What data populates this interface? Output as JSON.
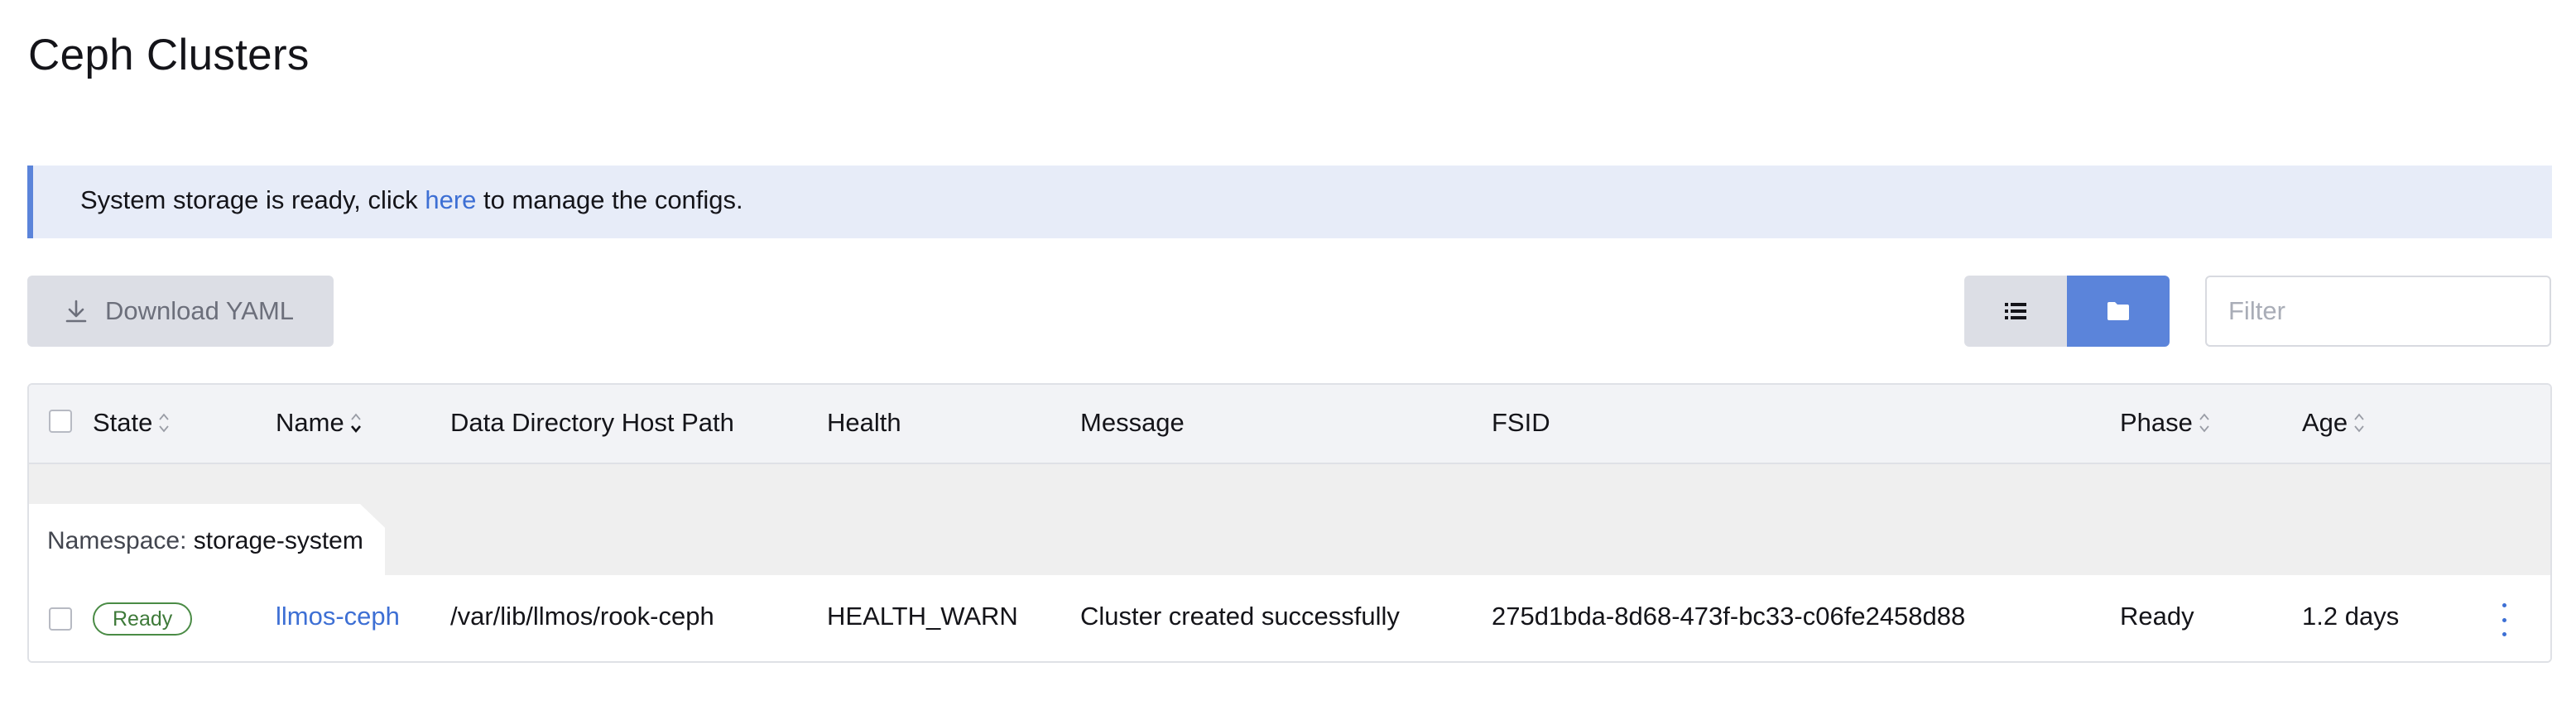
{
  "page": {
    "title": "Ceph Clusters"
  },
  "banner": {
    "text_before": "System storage is ready, click ",
    "link_text": "here",
    "text_after": " to manage the configs."
  },
  "toolbar": {
    "download_label": "Download YAML",
    "download_icon": "download-icon",
    "list_view_icon": "list-icon",
    "folder_view_icon": "folder-icon",
    "active_view": "folder",
    "filter_placeholder": "Filter",
    "filter_value": ""
  },
  "table": {
    "columns": [
      {
        "key": "state",
        "label": "State",
        "sortable": true
      },
      {
        "key": "name",
        "label": "Name",
        "sortable": true,
        "sorted": "asc"
      },
      {
        "key": "data_dir",
        "label": "Data Directory Host Path",
        "sortable": false
      },
      {
        "key": "health",
        "label": "Health",
        "sortable": false
      },
      {
        "key": "message",
        "label": "Message",
        "sortable": false
      },
      {
        "key": "fsid",
        "label": "FSID",
        "sortable": false
      },
      {
        "key": "phase",
        "label": "Phase",
        "sortable": true
      },
      {
        "key": "age",
        "label": "Age",
        "sortable": true
      }
    ],
    "groups": [
      {
        "namespace_label": "Namespace:",
        "namespace": "storage-system",
        "rows": [
          {
            "state": "Ready",
            "name": "llmos-ceph",
            "data_dir": "/var/lib/llmos/rook-ceph",
            "health": "HEALTH_WARN",
            "message": "Cluster created successfully",
            "fsid": "275d1bda-8d68-473f-bc33-c06fe2458d88",
            "phase": "Ready",
            "age": "1.2 days"
          }
        ]
      }
    ]
  },
  "colors": {
    "accent": "#5b84da",
    "link": "#3d6fd4",
    "banner_bg": "#e7ecf8",
    "ready_badge": "#4a8b45"
  }
}
